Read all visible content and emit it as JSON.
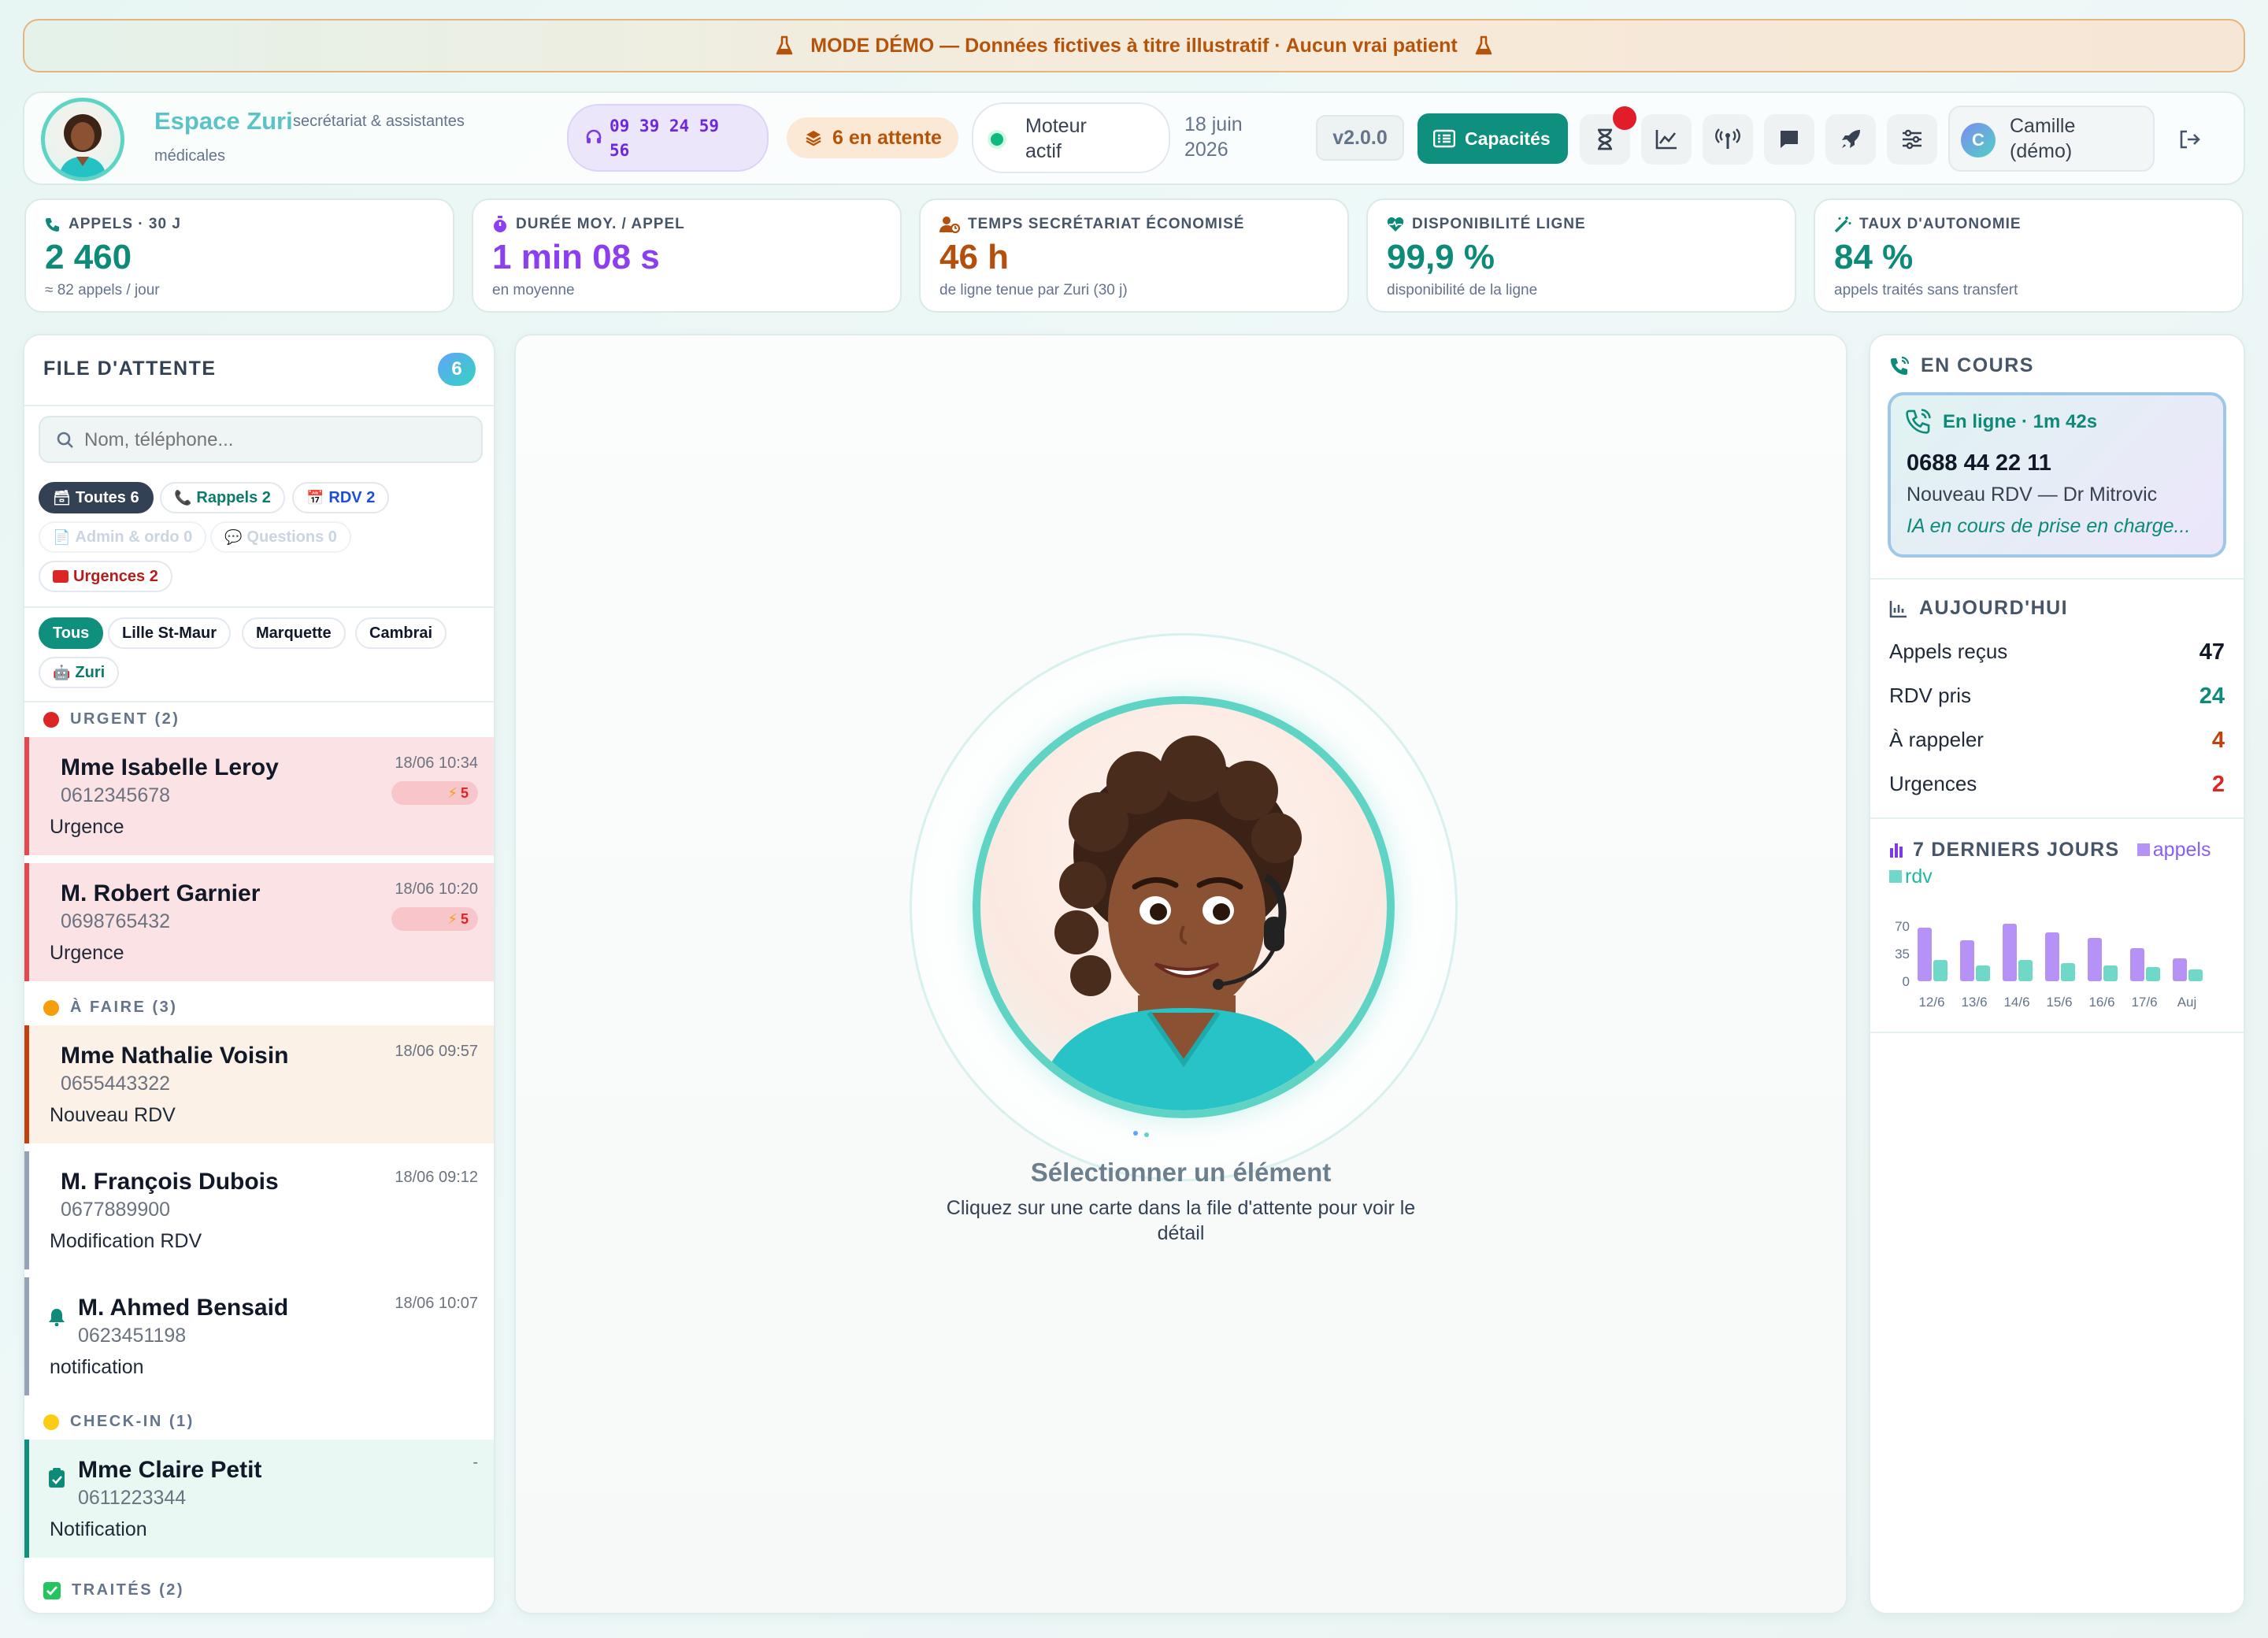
{
  "banner": {
    "text": "MODE DÉMO — Données fictives à titre illustratif · Aucun vrai patient"
  },
  "header": {
    "brand": "Espace Zuri",
    "subtitle_line1": "secrétariat & assistantes",
    "subtitle_line2": "médicales",
    "phone_line1": "09 39 24 59",
    "phone_line2": "56",
    "pending": "6 en attente",
    "engine_line1": "Moteur",
    "engine_line2": "actif",
    "date_line1": "18 juin",
    "date_line2": "2026",
    "version": "v2.0.0",
    "capabilities": "Capacités",
    "user_initial": "C",
    "user_line1": "Camille",
    "user_line2": "(démo)"
  },
  "stats": [
    {
      "label": "APPELS · 30 J",
      "value": "2 460",
      "sub": "≈ 82 appels / jour",
      "color": "#0e8a78"
    },
    {
      "label": "DURÉE MOY. / APPEL",
      "value": "1 min 08 s",
      "sub": "en moyenne",
      "color": "#8b3ff0"
    },
    {
      "label": "TEMPS SECRÉTARIAT ÉCONOMISÉ",
      "value": "46 h",
      "sub": "de ligne tenue par Zuri (30 j)",
      "color": "#b4500c"
    },
    {
      "label": "DISPONIBILITÉ LIGNE",
      "value": "99,9 %",
      "sub": "disponibilité de la ligne",
      "color": "#0e8a78"
    },
    {
      "label": "TAUX D'AUTONOMIE",
      "value": "84 %",
      "sub": "appels traités sans transfert",
      "color": "#0e8a78"
    }
  ],
  "queue": {
    "title": "FILE D'ATTENTE",
    "count": "6",
    "search_placeholder": "Nom, téléphone...",
    "filters": {
      "all": "Toutes 6",
      "calls": "Rappels 2",
      "rdv": "RDV 2",
      "admin": "Admin & ordo 0",
      "questions": "Questions 0",
      "urgent": "Urgences 2"
    },
    "sites": {
      "all": "Tous",
      "s1": "Lille St-Maur",
      "s2": "Marquette",
      "s3": "Cambrai",
      "zuri": "Zuri"
    },
    "sections": {
      "urgent": "URGENT (2)",
      "todo": "À FAIRE (3)",
      "checkin": "CHECK-IN (1)",
      "done": "TRAITÉS (2)"
    },
    "items": [
      {
        "name": "Mme Isabelle Leroy",
        "phone": "0612345678",
        "type": "Urgence",
        "time": "18/06 10:34",
        "prio": "5"
      },
      {
        "name": "M. Robert Garnier",
        "phone": "0698765432",
        "type": "Urgence",
        "time": "18/06 10:20",
        "prio": "5"
      },
      {
        "name": "Mme Nathalie Voisin",
        "phone": "0655443322",
        "type": "Nouveau RDV",
        "time": "18/06 09:57"
      },
      {
        "name": "M. François Dubois",
        "phone": "0677889900",
        "type": "Modification RDV",
        "time": "18/06 09:12"
      },
      {
        "name": "M. Ahmed Bensaid",
        "phone": "0623451198",
        "type": "notification",
        "time": "18/06 10:07"
      },
      {
        "name": "Mme Claire Petit",
        "phone": "0611223344",
        "type": "Notification",
        "time": "-"
      }
    ]
  },
  "center": {
    "title": "Sélectionner un élément",
    "desc_line1": "Cliquez sur une carte dans la file d'attente pour voir le",
    "desc_line2": "détail"
  },
  "right": {
    "live_title": "EN COURS",
    "live_status": "En ligne · 1m 42s",
    "live_phone": "0688 44 22 11",
    "live_reason": "Nouveau RDV — Dr Mitrovic",
    "live_note": "IA en cours de prise en charge...",
    "today_title": "AUJOURD'HUI",
    "today": [
      {
        "label": "Appels reçus",
        "value": "47",
        "color": "#111827"
      },
      {
        "label": "RDV pris",
        "value": "24",
        "color": "#0e8a78"
      },
      {
        "label": "À rappeler",
        "value": "4",
        "color": "#c2410c"
      },
      {
        "label": "Urgences",
        "value": "2",
        "color": "#dc2626"
      }
    ],
    "week_title": "7 DERNIERS JOURS",
    "legend_calls": "appels",
    "legend_rdv": "rdv"
  },
  "chart_data": {
    "type": "bar",
    "categories": [
      "12/6",
      "13/6",
      "14/6",
      "15/6",
      "16/6",
      "17/6",
      "Auj"
    ],
    "series": [
      {
        "name": "appels",
        "values": [
          68,
          52,
          73,
          62,
          55,
          42,
          29
        ]
      },
      {
        "name": "rdv",
        "values": [
          27,
          20,
          27,
          23,
          20,
          18,
          15
        ]
      }
    ],
    "yticks": [
      "70",
      "35",
      "0"
    ],
    "ylim": [
      0,
      80
    ]
  },
  "colors": {
    "teal": "#12a48e",
    "purple": "#b692f6",
    "mint": "#6fd8c8",
    "urgentbg": "#fbe2e4",
    "todobg": "#fbf1e7",
    "checkbg": "#e9f8f2"
  }
}
